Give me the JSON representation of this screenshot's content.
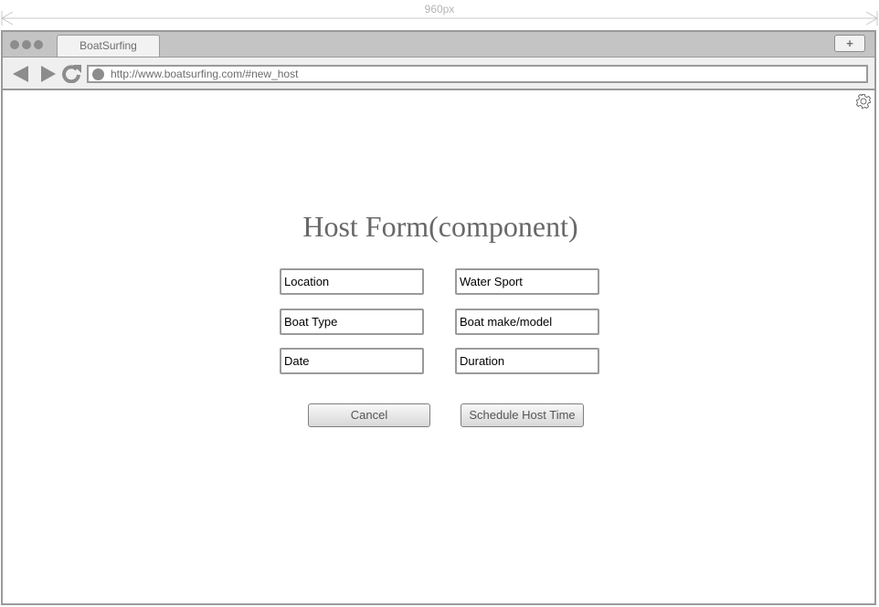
{
  "annotation": {
    "width_label": "960px"
  },
  "browser": {
    "tab_title": "BoatSurfing",
    "new_tab_label": "+",
    "url": "http://www.boatsurfing.com/#new_host"
  },
  "form": {
    "title": "Host Form(component)",
    "fields": {
      "location": "Location",
      "water_sport": "Water Sport",
      "boat_type": "Boat Type",
      "boat_make_model": "Boat make/model",
      "date": "Date",
      "duration": "Duration"
    },
    "buttons": {
      "cancel": "Cancel",
      "schedule": "Schedule Host Time"
    }
  }
}
